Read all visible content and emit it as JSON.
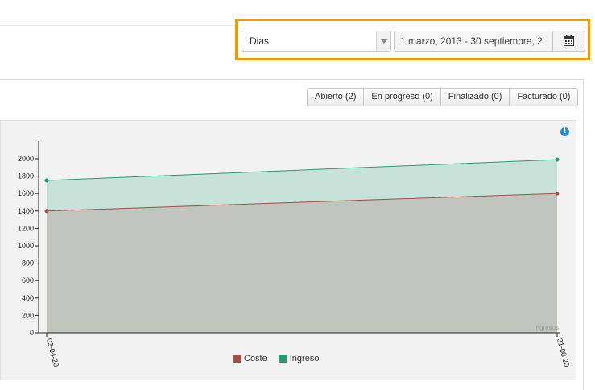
{
  "filters": {
    "period_value": "Dias",
    "date_range_value": "1 marzo, 2013 - 30 septiembre, 2"
  },
  "status_buttons": [
    {
      "label": "Abierto (2)"
    },
    {
      "label": "En progreso (0)"
    },
    {
      "label": "Finalizado (0)"
    },
    {
      "label": "Facturado (0)"
    }
  ],
  "chart": {
    "info_icon": "info-icon",
    "watermark": "ingresos",
    "colors": {
      "coste": "#a05048",
      "ingreso": "#2a9a6e",
      "highlight": "#f29a00"
    }
  },
  "chart_data": {
    "type": "area",
    "x": [
      "03-04-20",
      "31-08-20"
    ],
    "ylim": [
      0,
      2000
    ],
    "yticks": [
      0,
      200,
      400,
      600,
      800,
      1000,
      1200,
      1400,
      1600,
      1800,
      2000
    ],
    "series": [
      {
        "name": "Coste",
        "values": [
          1400,
          1600
        ],
        "color": "#a05048"
      },
      {
        "name": "Ingreso",
        "values": [
          1750,
          1990
        ],
        "color": "#2a9a6e"
      }
    ],
    "legend_position": "bottom-center",
    "grid": false
  }
}
